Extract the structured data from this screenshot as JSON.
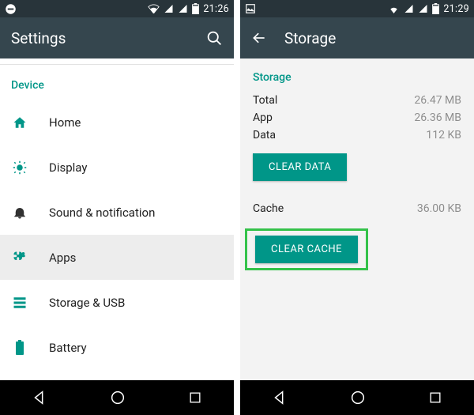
{
  "left": {
    "status_time": "21:26",
    "title": "Settings",
    "section": "Device",
    "items": [
      {
        "label": "Home",
        "icon": "home-icon"
      },
      {
        "label": "Display",
        "icon": "display-icon"
      },
      {
        "label": "Sound & notification",
        "icon": "bell-icon"
      },
      {
        "label": "Apps",
        "icon": "apps-icon"
      },
      {
        "label": "Storage & USB",
        "icon": "storage-icon"
      },
      {
        "label": "Battery",
        "icon": "battery-icon"
      }
    ]
  },
  "right": {
    "status_time": "21:29",
    "title": "Storage",
    "section": "Storage",
    "rows": {
      "total_k": "Total",
      "total_v": "26.47 MB",
      "app_k": "App",
      "app_v": "26.36 MB",
      "data_k": "Data",
      "data_v": "112 KB",
      "cache_k": "Cache",
      "cache_v": "36.00 KB"
    },
    "btn_clear_data": "CLEAR DATA",
    "btn_clear_cache": "CLEAR CACHE"
  },
  "colors": {
    "teal": "#009688",
    "actionbar": "#35464e",
    "statusbar": "#28343a",
    "highlight": "#34c24a"
  }
}
